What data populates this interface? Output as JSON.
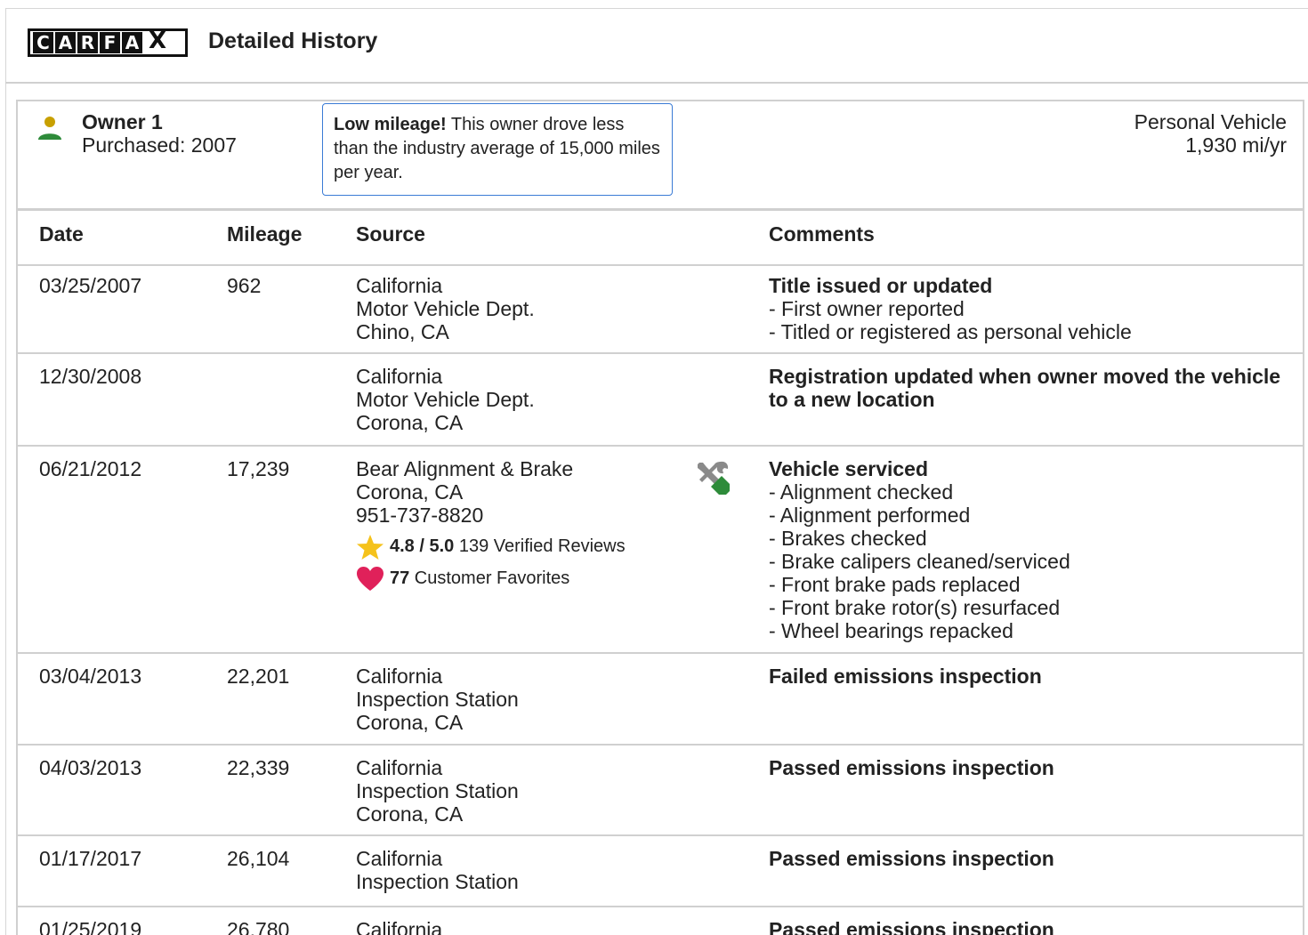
{
  "header": {
    "logo_letters": [
      "C",
      "A",
      "R",
      "F",
      "A",
      "X"
    ],
    "title": "Detailed History"
  },
  "owner": {
    "name": "Owner 1",
    "purchased": "Purchased: 2007",
    "callout_bold": "Low mileage!",
    "callout_text": " This owner drove less than the industry average of 15,000 miles per year.",
    "vehicle_type": "Personal Vehicle",
    "mileage_rate": "1,930 mi/yr"
  },
  "table": {
    "headers": {
      "date": "Date",
      "mileage": "Mileage",
      "source": "Source",
      "comments": "Comments"
    },
    "rows": [
      {
        "date": "03/25/2007",
        "mileage": "962",
        "source": [
          "California",
          "Motor Vehicle Dept.",
          "Chino, CA"
        ],
        "comment_title": "Title issued or updated",
        "comment_details": [
          "- First owner reported",
          "- Titled or registered as personal vehicle"
        ]
      },
      {
        "date": "12/30/2008",
        "mileage": "",
        "source": [
          "California",
          "Motor Vehicle Dept.",
          "Corona, CA"
        ],
        "comment_title": "Registration updated when owner moved the vehicle to a new location",
        "comment_details": []
      },
      {
        "date": "06/21/2012",
        "mileage": "17,239",
        "source": [
          "Bear Alignment & Brake",
          "Corona, CA",
          "951-737-8820"
        ],
        "rating": "4.8 / 5.0",
        "reviews": " 139 Verified Reviews",
        "favorites_count": "77",
        "favorites_label": " Customer Favorites",
        "comment_title": "Vehicle serviced",
        "comment_details": [
          "- Alignment checked",
          "- Alignment performed",
          "- Brakes checked",
          "- Brake calipers cleaned/serviced",
          "- Front brake pads replaced",
          "- Front brake rotor(s) resurfaced",
          "- Wheel bearings repacked"
        ]
      },
      {
        "date": "03/04/2013",
        "mileage": "22,201",
        "source": [
          "California",
          "Inspection Station",
          "Corona, CA"
        ],
        "comment_title": "Failed emissions inspection",
        "comment_details": []
      },
      {
        "date": "04/03/2013",
        "mileage": "22,339",
        "source": [
          "California",
          "Inspection Station",
          "Corona, CA"
        ],
        "comment_title": "Passed emissions inspection",
        "comment_details": []
      },
      {
        "date": "01/17/2017",
        "mileage": "26,104",
        "source": [
          "California",
          "Inspection Station"
        ],
        "comment_title": "Passed emissions inspection",
        "comment_details": []
      },
      {
        "date": "01/25/2019",
        "mileage": "26,780",
        "source": [
          "California"
        ],
        "comment_title": "Passed emissions inspection",
        "comment_details": []
      }
    ]
  },
  "icons": {
    "owner": "person-icon",
    "service": "wrench-screwdriver-icon",
    "rating": "star-icon",
    "favorites": "heart-icon"
  },
  "colors": {
    "callout_border": "#3a7bd5",
    "person_head": "#c8a000",
    "person_body": "#2e8b3a",
    "star": "#f5c21b",
    "heart": "#e0215a",
    "service_icon": "#2e8b3a"
  }
}
